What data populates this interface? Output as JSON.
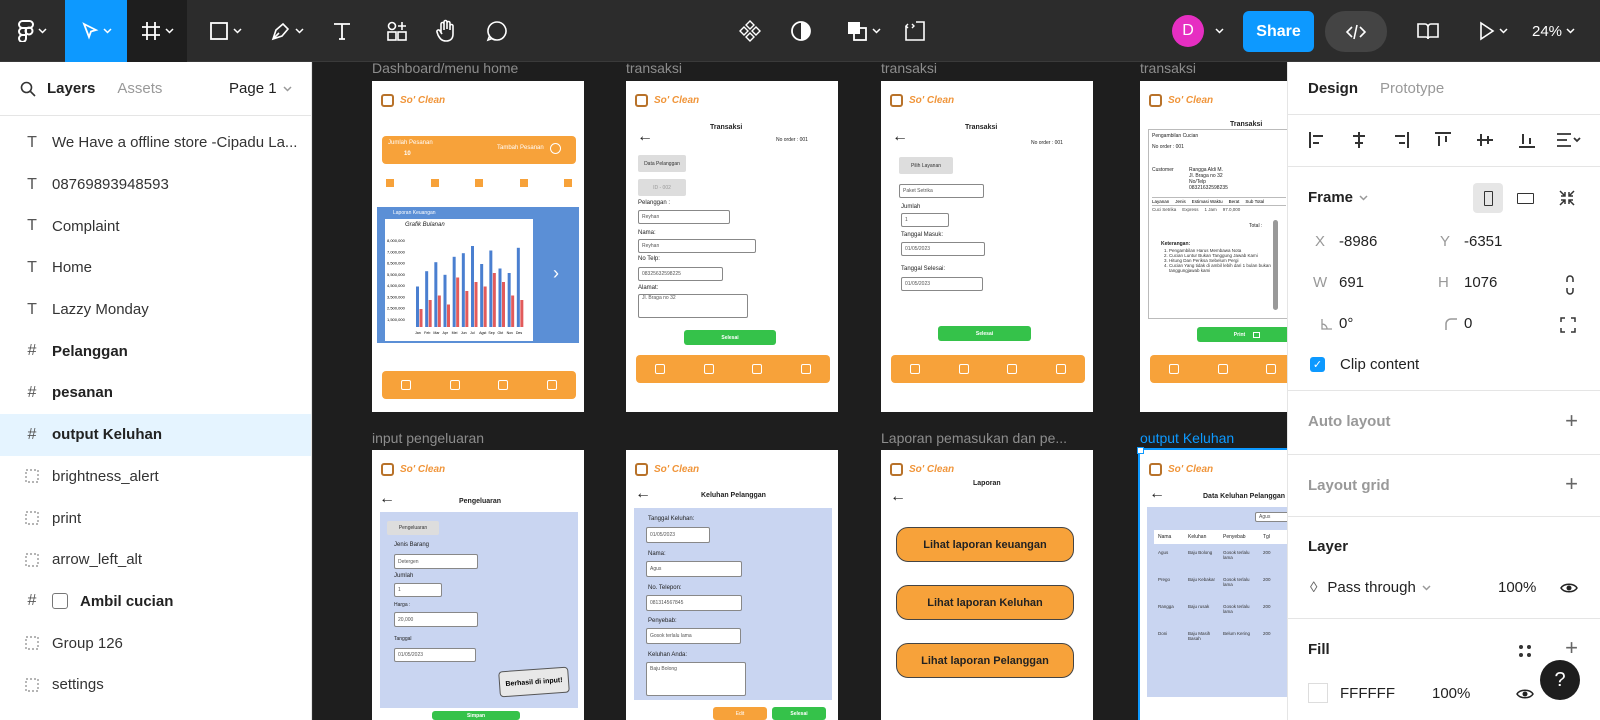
{
  "toolbar": {
    "share_label": "Share",
    "zoom_label": "24%",
    "avatar_initial": "D",
    "tools": [
      "main-menu",
      "move-tool",
      "frame-tool",
      "shape-tool",
      "pen-tool",
      "text-tool",
      "resources-tool",
      "hand-tool",
      "comment-tool"
    ],
    "center_tools": [
      "component-icon",
      "mask-icon",
      "boolean-icon",
      "dev-mode-icon"
    ]
  },
  "left_panel": {
    "tab_layers": "Layers",
    "tab_assets": "Assets",
    "page": "Page 1",
    "layers": [
      {
        "icon": "T",
        "name": "We Have a offline store -Cipadu La...",
        "bold": false
      },
      {
        "icon": "T",
        "name": "08769893948593",
        "bold": false
      },
      {
        "icon": "T",
        "name": "Complaint",
        "bold": false
      },
      {
        "icon": "T",
        "name": "Home",
        "bold": false
      },
      {
        "icon": "T",
        "name": "Lazzy Monday",
        "bold": false
      },
      {
        "icon": "#",
        "name": "Pelanggan",
        "bold": true
      },
      {
        "icon": "#",
        "name": "pesanan",
        "bold": true
      },
      {
        "icon": "#",
        "name": "output Keluhan",
        "bold": true,
        "selected": true
      },
      {
        "icon": "frame",
        "name": "brightness_alert",
        "bold": false
      },
      {
        "icon": "frame",
        "name": "print",
        "bold": false
      },
      {
        "icon": "frame",
        "name": "arrow_left_alt",
        "bold": false
      },
      {
        "icon": "#",
        "name": "Ambil cucian",
        "bold": true
      },
      {
        "icon": "frame",
        "name": "Group 126",
        "bold": false
      },
      {
        "icon": "frame",
        "name": "settings",
        "bold": false
      }
    ]
  },
  "canvas": {
    "labels": {
      "f1": "Dashboard/menu home",
      "f2": "transaksi",
      "f3": "transaksi",
      "f4": "transaksi",
      "f5": "input pengeluaran",
      "f7": "Laporan pemasukan dan pe...",
      "f8": "output Keluhan"
    },
    "logo": "So' Clean",
    "home": {
      "jumlah": "Jumlah Pesanan",
      "count": "10",
      "tambah": "Tambah Pesanan",
      "laporan": "Laporan Keuangan",
      "grafik": "Grafik Bulanan",
      "ylabels": [
        "8,000,000",
        "7,000,000",
        "6,500,000",
        "5,500,000",
        "4,500,000",
        "3,500,000",
        "2,500,000",
        "1,500,000"
      ],
      "xlabels": [
        "Jan",
        "Feb",
        "Mar",
        "Apr",
        "Mei",
        "Jun",
        "Jul",
        "Agst",
        "Sep",
        "Okt",
        "Nov",
        "Des"
      ],
      "bars_blue": [
        0.45,
        0.62,
        0.72,
        0.58,
        0.78,
        0.82,
        0.9,
        0.7,
        0.85,
        0.65,
        0.6,
        0.88
      ],
      "bars_red": [
        0.2,
        0.3,
        0.35,
        0.25,
        0.55,
        0.4,
        0.5,
        0.45,
        0.6,
        0.5,
        0.35,
        0.3
      ]
    },
    "t1": {
      "title": "Transaksi",
      "order": "No order : 001",
      "data": "Data Pelanggan",
      "id": "ID - 002",
      "pelanggan": "Pelanggan :",
      "pelanggan_val": "Reyhan",
      "nama": "Nama:",
      "nama_val": "Reyhan",
      "telp": "No Telp:",
      "telp_val": "08325632598225",
      "alamat": "Alamat:",
      "alamat_val": "Jl. Braga no 32",
      "selesai": "Selesai"
    },
    "t2": {
      "title": "Transaksi",
      "order": "No order : 001",
      "pilih": "Pilih Layanan",
      "paket": "Paket Setrika",
      "jumlah": "Jumlah",
      "jumlah_val": "1",
      "masuk": "Tanggal Masuk:",
      "masuk_val": "01/05/2023",
      "selesai_lbl": "Tanggal Selesai:",
      "selesai_val": "01/05/2023",
      "selesai": "Selesai"
    },
    "t3": {
      "title": "Transaksi",
      "head": "Pengambilan Cucian",
      "order": "No order : 001",
      "customer": "Customer",
      "cust_name": "Rangga Aldi M.",
      "cust_addr": "Jl. Braga no 32",
      "notelp": "No/Telp",
      "phone": "08321632598235",
      "cols": [
        "Layanan",
        "Jenis",
        "Estimasi Waktu",
        "Berat",
        "Sub Total"
      ],
      "row": [
        "Cuci Setrika",
        "Express",
        "1 Jam",
        "97.0,000",
        ""
      ],
      "total": "Total :",
      "ket": "Keterangan:",
      "notes": [
        "Pengambilan Harus Membawa Nota",
        "Cucian Luntur Bukan Tanggung Jawab Kami",
        "Hitung Dan Periksa Sebelum Pergi",
        "Cucian Yang tidak di ambil lebih dari 1 bulan bukan tanggungjawab kami"
      ],
      "print": "Print"
    },
    "peng": {
      "title": "Pengeluaran",
      "tab": "Pengeluaran",
      "jenis": "Jenis Barang",
      "jenis_val": "Detergen",
      "jumlah": "Jumlah",
      "jumlah_val": "1",
      "harga": "Harga :",
      "harga_val": "20,000",
      "tanggal": "Tanggal",
      "tanggal_val": "01/05/2023",
      "toast": "Berhasil di input!",
      "simpan": "Simpan"
    },
    "kel": {
      "title": "Keluhan Pelanggan",
      "tgl": "Tanggal Keluhan:",
      "tgl_val": "01/05/2023",
      "nama": "Nama:",
      "nama_val": "Agus",
      "telp": "No. Telepon:",
      "telp_val": "081314567845",
      "penyebab": "Penyebab:",
      "penyebab_val": "Gosok terlalu lama",
      "keluhan": "Keluhan Anda:",
      "keluhan_val": "Baju Bolong",
      "edit": "Edit",
      "selesai": "Selesai"
    },
    "lap": {
      "title": "Laporan",
      "b1": "Lihat laporan keuangan",
      "b2": "Lihat laporan Keluhan",
      "b3": "Lihat laporan Pelanggan"
    },
    "out": {
      "title": "Data Keluhan Pelanggan",
      "search": "Agus",
      "cols": [
        "Nama",
        "Keluhan",
        "Penyebab",
        "Tgl"
      ],
      "rows": [
        [
          "Agus",
          "Baju Bolong",
          "Gosok terlalu lama",
          "200"
        ],
        [
          "Prego",
          "Baju Kebakar",
          "Gosok terlalu lama",
          "200"
        ],
        [
          "Rangga",
          "Baju rusak",
          "Gosok terlalu lama",
          "200"
        ],
        [
          "Doni",
          "Baju Masih Basah",
          "Belum Kering",
          "200"
        ]
      ]
    }
  },
  "right_panel": {
    "tab_design": "Design",
    "tab_prototype": "Prototype",
    "frame_label": "Frame",
    "x_label": "X",
    "x": "-8986",
    "y_label": "Y",
    "y": "-6351",
    "w_label": "W",
    "w": "691",
    "h_label": "H",
    "h": "1076",
    "rotation": "0°",
    "radius": "0",
    "clip": "Clip content",
    "auto_layout": "Auto layout",
    "layout_grid": "Layout grid",
    "layer": "Layer",
    "blend": "Pass through",
    "opacity": "100%",
    "fill": "Fill",
    "fill_hex": "FFFFFF",
    "fill_opacity": "100%"
  },
  "help": "?",
  "colors": {
    "accent": "#0d99ff",
    "brand_orange": "#f7a23a",
    "green": "#35c24a",
    "share": "#0d99ff",
    "avatar": "#e62fc2"
  }
}
